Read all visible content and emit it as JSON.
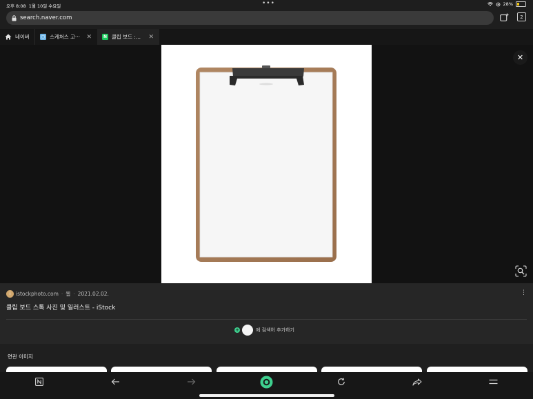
{
  "status": {
    "time": "오후 8:08",
    "date": "1월 10일 수요일",
    "battery": "28%",
    "battery_level": 0.28
  },
  "url": {
    "address": "search.naver.com",
    "tab_count": "2"
  },
  "tabs": [
    {
      "label": "네이버"
    },
    {
      "label": "스케쳐스 고···"
    },
    {
      "label": "클립 보드 :..."
    }
  ],
  "result": {
    "source": "istockphoto.com",
    "kind": "웹",
    "date": "2021.02.02.",
    "title": "클립 보드 스톡 사진 및 일러스트 - iStock",
    "add_keyword": "에 검색어 추가하기"
  },
  "related": {
    "label": "연관 이미지"
  },
  "colors": {
    "accent_green": "#3ecf8e",
    "favicon": "#d2a86e",
    "clipboard": "#a67b57"
  }
}
